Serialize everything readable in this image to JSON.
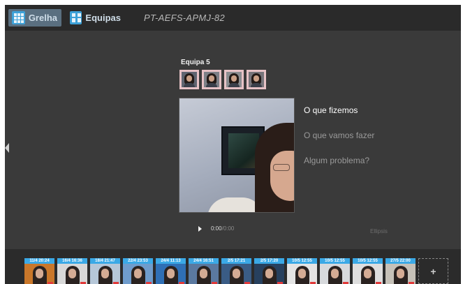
{
  "header": {
    "tabs": [
      {
        "label": "Grelha",
        "icon": "grid-icon",
        "active": true
      },
      {
        "label": "Equipas",
        "icon": "team-icon",
        "active": false
      }
    ],
    "code": "PT-AEFS-APMJ-82"
  },
  "team": {
    "name": "Equipa 5",
    "members": [
      "member-1",
      "member-2",
      "member-3",
      "member-4"
    ]
  },
  "questions": [
    "O que fizemos",
    "O que vamos fazer",
    "Algum problema?"
  ],
  "player": {
    "current": "0:00",
    "total": "0:00",
    "separator": "/"
  },
  "ellipsis_text": "Ellipsis",
  "thumbnails": [
    {
      "stamp": "11/4 20:24",
      "bg": "#c9772a"
    },
    {
      "stamp": "16/4 16:36",
      "bg": "#d8d8d8"
    },
    {
      "stamp": "18/4 21:47",
      "bg": "#b6c7d8"
    },
    {
      "stamp": "22/4 23:53",
      "bg": "#6f9ccc"
    },
    {
      "stamp": "24/4 11:13",
      "bg": "#2f6fb5"
    },
    {
      "stamp": "24/4 16:51",
      "bg": "#5b79a0"
    },
    {
      "stamp": "2/5 17:21",
      "bg": "#3a5c85"
    },
    {
      "stamp": "2/5 17:20",
      "bg": "#27405e"
    },
    {
      "stamp": "10/5 12:55",
      "bg": "#e4e4e4"
    },
    {
      "stamp": "10/5 12:55",
      "bg": "#d7d9dc"
    },
    {
      "stamp": "10/5 12:55",
      "bg": "#dedede"
    },
    {
      "stamp": "27/5 22:00",
      "bg": "#c6c1b8"
    }
  ],
  "add_label": "+",
  "colors": {
    "accent": "#3da1d8",
    "stamp": "#3ba9e6",
    "background": "#3a3a3a",
    "topbar": "#2a2a2a"
  }
}
